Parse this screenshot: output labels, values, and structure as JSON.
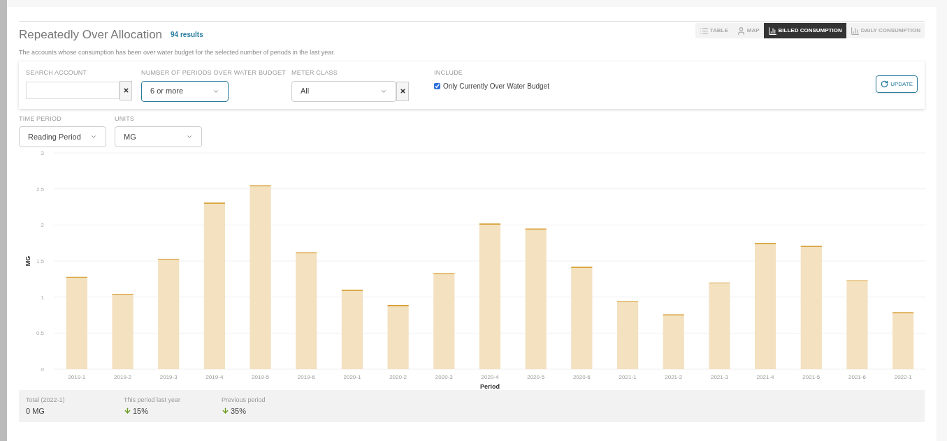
{
  "header": {
    "title": "Repeatedly Over Allocation",
    "count": "94 results",
    "description": "The accounts whose consumption has been over water budget for the selected number of periods in the last year."
  },
  "view_tabs": [
    {
      "label": "TABLE",
      "kind": "table",
      "selected": false
    },
    {
      "label": "MAP",
      "kind": "map",
      "selected": false
    },
    {
      "label": "BILLED CONSUMPTION",
      "kind": "bars",
      "selected": true
    },
    {
      "label": "DAILY CONSUMPTION",
      "kind": "bars",
      "selected": false
    }
  ],
  "filters": {
    "search_account": {
      "label": "SEARCH ACCOUNT"
    },
    "periods": {
      "label": "NUMBER OF PERIODS OVER WATER BUDGET",
      "value": "6 or more"
    },
    "meter_class": {
      "label": "METER CLASS",
      "value": "All"
    },
    "include": {
      "label": "INCLUDE",
      "option": "Only Currently Over Water Budget",
      "checked": true
    },
    "update_button": "UPDATE"
  },
  "time_period": {
    "label": "TIME PERIOD",
    "value": "Reading Period"
  },
  "units": {
    "label": "UNITS",
    "value": "MG"
  },
  "chart_data": {
    "type": "bar",
    "xlabel": "Period",
    "ylabel": "MG",
    "categories": [
      "2019-1",
      "2019-2",
      "2019-3",
      "2019-4",
      "2019-5",
      "2019-6",
      "2020-1",
      "2020-2",
      "2020-3",
      "2020-4",
      "2020-5",
      "2020-6",
      "2021-1",
      "2021-2",
      "2021-3",
      "2021-4",
      "2021-5",
      "2021-6",
      "2022-1"
    ],
    "values": [
      1.28,
      1.04,
      1.53,
      2.31,
      2.55,
      1.62,
      1.1,
      0.89,
      1.33,
      2.02,
      1.95,
      1.42,
      0.94,
      0.76,
      1.2,
      1.75,
      1.71,
      1.23,
      0.79
    ],
    "ylim": [
      0,
      3
    ],
    "yticks": [
      0,
      0.5,
      1,
      1.5,
      2,
      2.5,
      3
    ],
    "grid": true
  },
  "summary": [
    {
      "label": "Total (2022-1)",
      "value": "0 MG",
      "down": false
    },
    {
      "label": "This period last year",
      "value": "15%",
      "down": true
    },
    {
      "label": "Previous period",
      "value": "35%",
      "down": true
    }
  ]
}
